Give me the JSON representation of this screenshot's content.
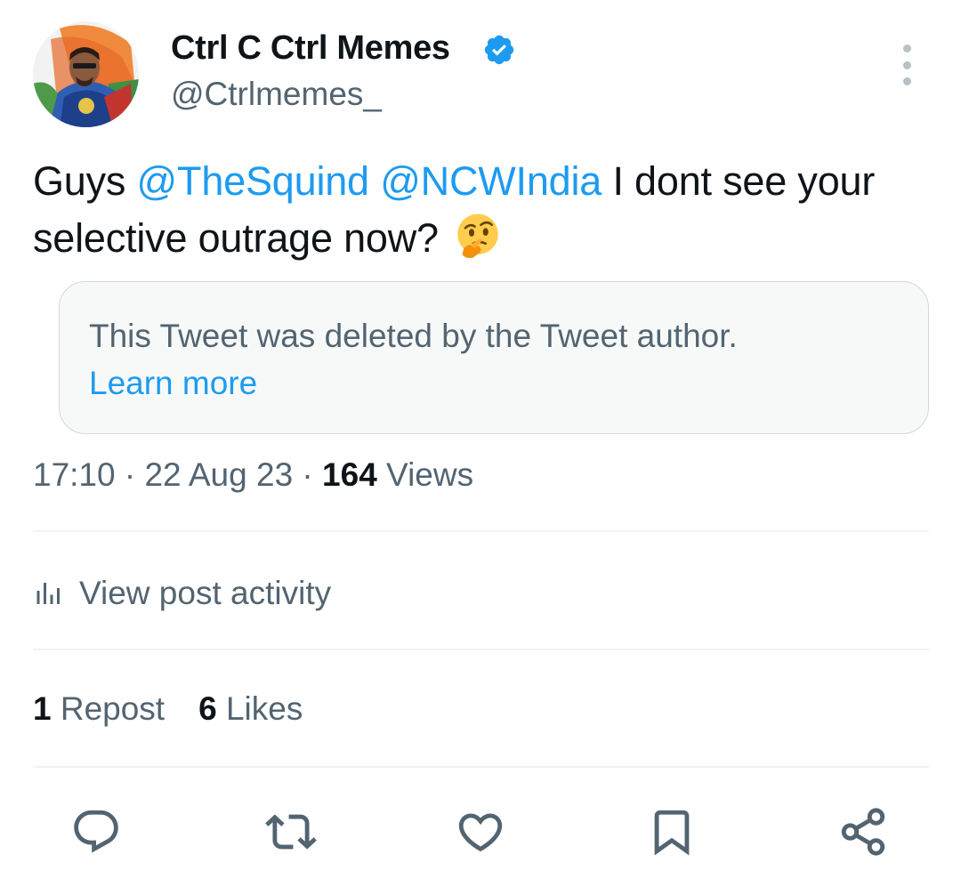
{
  "author": {
    "display_name": "Ctrl C Ctrl Memes",
    "handle": "@Ctrlmemes_",
    "verified": true,
    "avatar": "avatar-image"
  },
  "tweet": {
    "segments": [
      {
        "text": "Guys ",
        "type": "text"
      },
      {
        "text": "@TheSquind",
        "type": "mention"
      },
      {
        "text": " ",
        "type": "text"
      },
      {
        "text": "@NCWIndia",
        "type": "mention"
      },
      {
        "text": " I dont see your selective outrage now? ",
        "type": "text"
      }
    ],
    "emoji": "thinking-face"
  },
  "quote": {
    "deleted_text": "This Tweet was deleted by the Tweet author.",
    "learn_more": "Learn more"
  },
  "meta": {
    "time": "17:10",
    "separator1": " · ",
    "date": "22 Aug 23",
    "separator2": " · ",
    "views_count": "164",
    "views_label": " Views"
  },
  "activity": {
    "label": "View post activity",
    "icon": "analytics-icon"
  },
  "counts": {
    "reposts_count": "1",
    "reposts_label": " Repost",
    "likes_count": "6",
    "likes_label": " Likes"
  },
  "actions": [
    "reply-icon",
    "repost-icon",
    "like-icon",
    "bookmark-icon",
    "share-icon"
  ],
  "colors": {
    "accent": "#1d9bf0",
    "text": "#0f1419",
    "secondary": "#536471",
    "border": "#cfd9de",
    "quote_bg": "#f7f9f9"
  }
}
